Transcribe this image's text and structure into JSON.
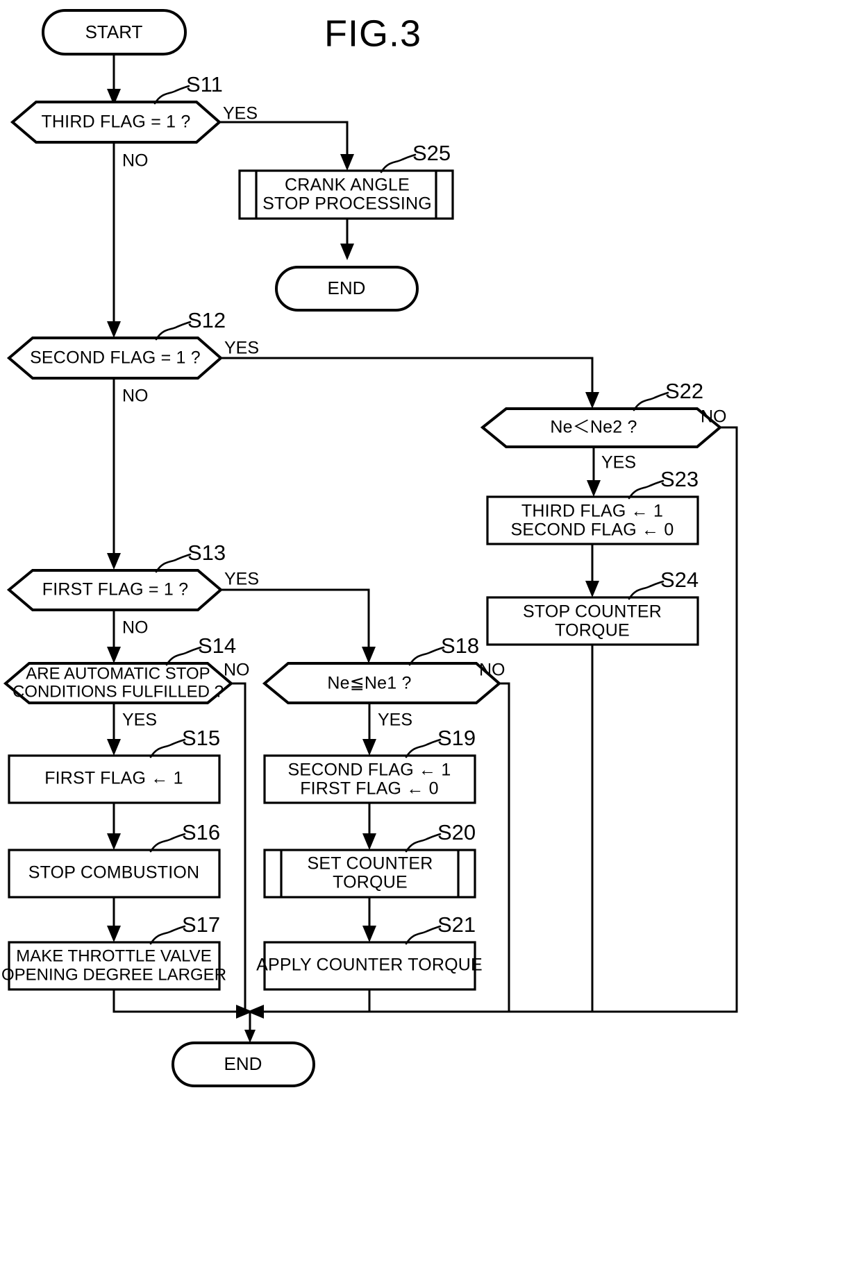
{
  "figure": {
    "title": "FIG.3",
    "terminators": {
      "start": "START",
      "end_top": "END",
      "end_bottom": "END"
    },
    "nodes": [
      {
        "id": "S11",
        "step_label": "S11",
        "shape": "decision",
        "text": "THIRD FLAG = 1 ?",
        "branch_yes": "YES",
        "branch_no": "NO"
      },
      {
        "id": "S25",
        "step_label": "S25",
        "shape": "predefined-process",
        "line1": "CRANK ANGLE",
        "line2": "STOP PROCESSING"
      },
      {
        "id": "S12",
        "step_label": "S12",
        "shape": "decision",
        "text": "SECOND FLAG = 1 ?",
        "branch_yes": "YES",
        "branch_no": "NO"
      },
      {
        "id": "S22",
        "step_label": "S22",
        "shape": "decision",
        "text": "Ne＜Ne2 ?",
        "branch_yes": "YES",
        "branch_no": "NO"
      },
      {
        "id": "S23",
        "step_label": "S23",
        "shape": "process",
        "line1": "THIRD FLAG ← 1",
        "line2": "SECOND FLAG ← 0"
      },
      {
        "id": "S24",
        "step_label": "S24",
        "shape": "process",
        "line1": "STOP COUNTER",
        "line2": "TORQUE"
      },
      {
        "id": "S13",
        "step_label": "S13",
        "shape": "decision",
        "text": "FIRST FLAG = 1 ?",
        "branch_yes": "YES",
        "branch_no": "NO"
      },
      {
        "id": "S14",
        "step_label": "S14",
        "shape": "decision",
        "line1": "ARE AUTOMATIC STOP",
        "line2": "CONDITIONS FULFILLED ?",
        "branch_yes": "YES",
        "branch_no": "NO"
      },
      {
        "id": "S18",
        "step_label": "S18",
        "shape": "decision",
        "text": "Ne≦Ne1 ?",
        "branch_yes": "YES",
        "branch_no": "NO"
      },
      {
        "id": "S15",
        "step_label": "S15",
        "shape": "process",
        "line1": "FIRST FLAG ← 1"
      },
      {
        "id": "S19",
        "step_label": "S19",
        "shape": "process",
        "line1": "SECOND FLAG ← 1",
        "line2": "FIRST FLAG ← 0"
      },
      {
        "id": "S16",
        "step_label": "S16",
        "shape": "process",
        "line1": "STOP COMBUSTION"
      },
      {
        "id": "S20",
        "step_label": "S20",
        "shape": "predefined-process",
        "line1": "SET COUNTER",
        "line2": "TORQUE"
      },
      {
        "id": "S17",
        "step_label": "S17",
        "shape": "process",
        "line1": "MAKE THROTTLE VALVE",
        "line2": "OPENING DEGREE LARGER"
      },
      {
        "id": "S21",
        "step_label": "S21",
        "shape": "process",
        "line1": "APPLY COUNTER TORQUE"
      }
    ],
    "colors": {
      "stroke": "#000000",
      "fill": "#ffffff",
      "background": "#ffffff"
    }
  }
}
